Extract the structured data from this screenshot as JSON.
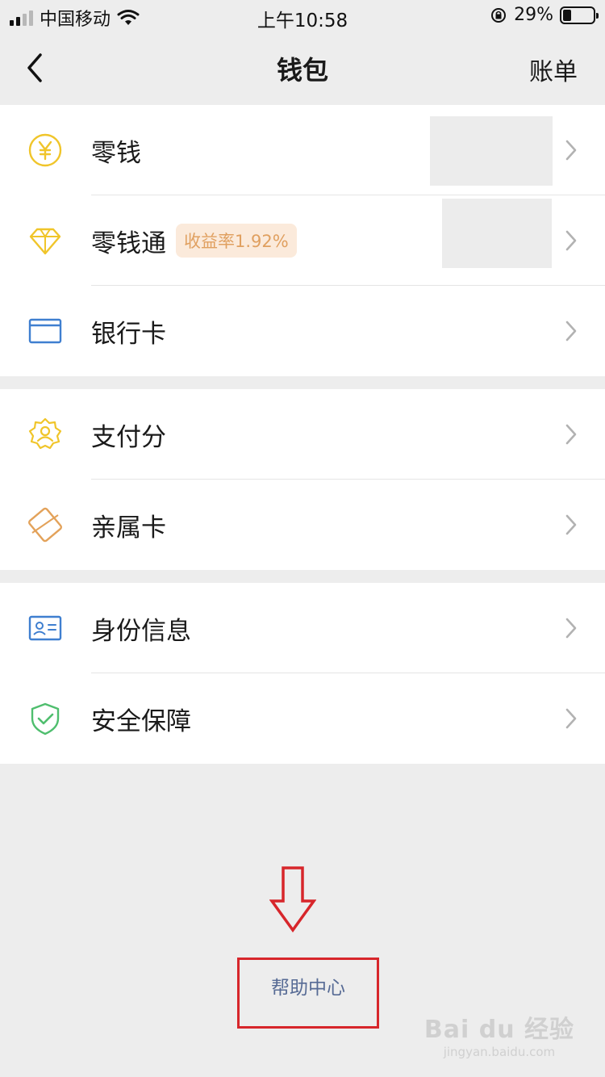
{
  "status_bar": {
    "carrier": "中国移动",
    "time": "上午10:58",
    "battery_percent": "29%",
    "battery_level": 0.29,
    "signal_icon": "signal-icon",
    "wifi_icon": "wifi-icon",
    "rotation_lock_icon": "rotation-lock-icon"
  },
  "nav": {
    "title": "钱包",
    "right_label": "账单",
    "back_icon": "chevron-left-icon"
  },
  "groups": [
    {
      "items": [
        {
          "label": "零钱",
          "icon": "yuan-coin-icon",
          "color": "#f0c52a"
        },
        {
          "label": "零钱通",
          "badge": "收益率1.92%",
          "icon": "diamond-icon",
          "color": "#f0c52a"
        },
        {
          "label": "银行卡",
          "icon": "card-icon",
          "color": "#3f7fd0"
        }
      ]
    },
    {
      "items": [
        {
          "label": "支付分",
          "icon": "badge-person-icon",
          "color": "#f0c52a"
        },
        {
          "label": "亲属卡",
          "icon": "family-card-icon",
          "color": "#e3a25a"
        }
      ]
    },
    {
      "items": [
        {
          "label": "身份信息",
          "icon": "id-card-icon",
          "color": "#3f7fd0"
        },
        {
          "label": "安全保障",
          "icon": "shield-check-icon",
          "color": "#4fbe6e"
        }
      ]
    }
  ],
  "help": {
    "label": "帮助中心",
    "annotation_color": "#d7262b",
    "link_color": "#576b95"
  },
  "watermark": {
    "main": "Bai du 经验",
    "sub": "jingyan.baidu.com"
  }
}
